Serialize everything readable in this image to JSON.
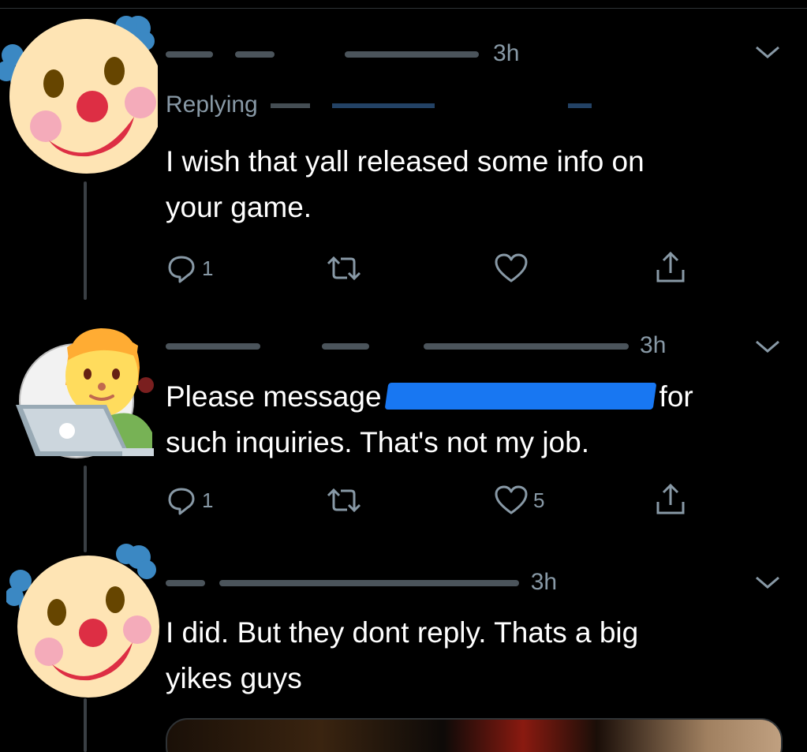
{
  "tweets": [
    {
      "meta_fragment": "3h",
      "replying_prefix": "Replying",
      "text_lines": [
        "I wish that yall released some info on",
        "your game."
      ],
      "reply_count": "1",
      "retweet_count": "",
      "like_count": "",
      "avatar_icon": "clown-face-icon"
    },
    {
      "meta_fragment": "3h",
      "text_before_mention": "Please message",
      "text_after_mention": "for",
      "text_line2": "such inquiries. That's not my job.",
      "reply_count": "1",
      "retweet_count": "",
      "like_count": "5",
      "avatar_icon": "technologist-icon"
    },
    {
      "meta_fragment": "3h",
      "text_lines": [
        "I did. But they dont reply. Thats a big",
        "yikes guys"
      ],
      "avatar_icon": "clown-face-icon"
    }
  ],
  "colors": {
    "background": "#000000",
    "text": "#ffffff",
    "muted": "#8899a6",
    "redaction": "#1877f2",
    "divider": "#2f3336"
  }
}
